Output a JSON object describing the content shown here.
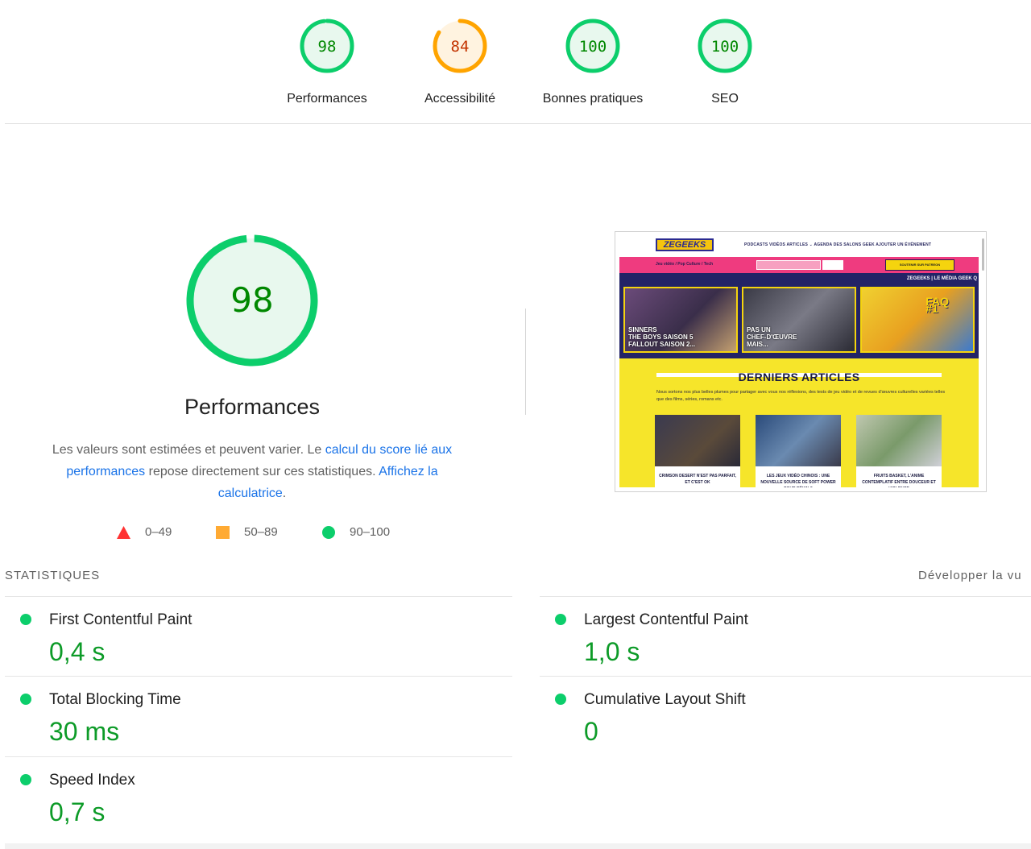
{
  "top_scores": [
    {
      "value": "98",
      "label": "Performances",
      "score": 98,
      "color": "#0cce6b",
      "text_color": "#008800",
      "fill": "#e8f8ee"
    },
    {
      "value": "84",
      "label": "Accessibilité",
      "score": 84,
      "color": "#ffa400",
      "text_color": "#c33300",
      "fill": "#fff3e0"
    },
    {
      "value": "100",
      "label": "Bonnes pratiques",
      "score": 100,
      "color": "#0cce6b",
      "text_color": "#008800",
      "fill": "#e8f8ee"
    },
    {
      "value": "100",
      "label": "SEO",
      "score": 100,
      "color": "#0cce6b",
      "text_color": "#008800",
      "fill": "#e8f8ee"
    }
  ],
  "performance": {
    "score": "98",
    "score_fraction": 0.98,
    "title": "Performances",
    "desc_1": "Les valeurs sont estimées et peuvent varier. Le ",
    "link_1": "calcul du score lié aux performances",
    "desc_2": " repose directement sur ces statistiques. ",
    "link_2": "Affichez la calculatrice",
    "desc_3": "."
  },
  "legend": [
    {
      "label": "0–49",
      "shape": "triangle-icon",
      "color": "#ff3333"
    },
    {
      "label": "50–89",
      "shape": "square-icon",
      "color": "#ffaa33"
    },
    {
      "label": "90–100",
      "shape": "circle-icon",
      "color": "#0cce6b"
    }
  ],
  "thumbnail": {
    "logo": "ZEGEEKS",
    "menu": "PODCASTS    VIDÉOS    ARTICLES ⌄    AGENDA DES SALONS GEEK    AJOUTER UN ÉVÉNEMENT",
    "tagline": "Jeu vidéo / Pop Culture / Tech",
    "cta": "SOUTENIR SUR PATREON",
    "band_tag": "ZEGEEKS | LE MÉDIA GEEK Q",
    "tile_1": "SINNERS\nTHE BOYS SAISON 5\nFALLOUT SAISON 2...",
    "tile_2": "PAS UN\nCHEF-D'ŒUVRE\nMAIS...",
    "tile_3": "FAQ\n#1",
    "section_title": "DERNIERS ARTICLES",
    "section_sub": "Nous sortons nos plus belles plumes pour partager avec vous nos réflexions, des tests de jeu vidéo et de revues d'œuvres culturelles variées telles que des films, séries, romans etc.",
    "card_1": "CRIMSON DESERT N'EST PAS PARFAIT, ET C'EST OK",
    "card_2": "LES JEUX VIDÉO CHINOIS : UNE NOUVELLE SOURCE DE SOFT POWER POUR PÉKIN ?",
    "card_3": "FRUITS BASKET, L'ANIME CONTEMPLATIF ENTRE DOUCEUR ET VIOLENCE"
  },
  "stats": {
    "heading": "STATISTIQUES",
    "expand_label": "Développer la vu",
    "metrics": [
      {
        "name": "First Contentful Paint",
        "value": "0,4 s"
      },
      {
        "name": "Largest Contentful Paint",
        "value": "1,0 s"
      },
      {
        "name": "Total Blocking Time",
        "value": "30 ms"
      },
      {
        "name": "Cumulative Layout Shift",
        "value": "0"
      },
      {
        "name": "Speed Index",
        "value": "0,7 s"
      }
    ]
  }
}
